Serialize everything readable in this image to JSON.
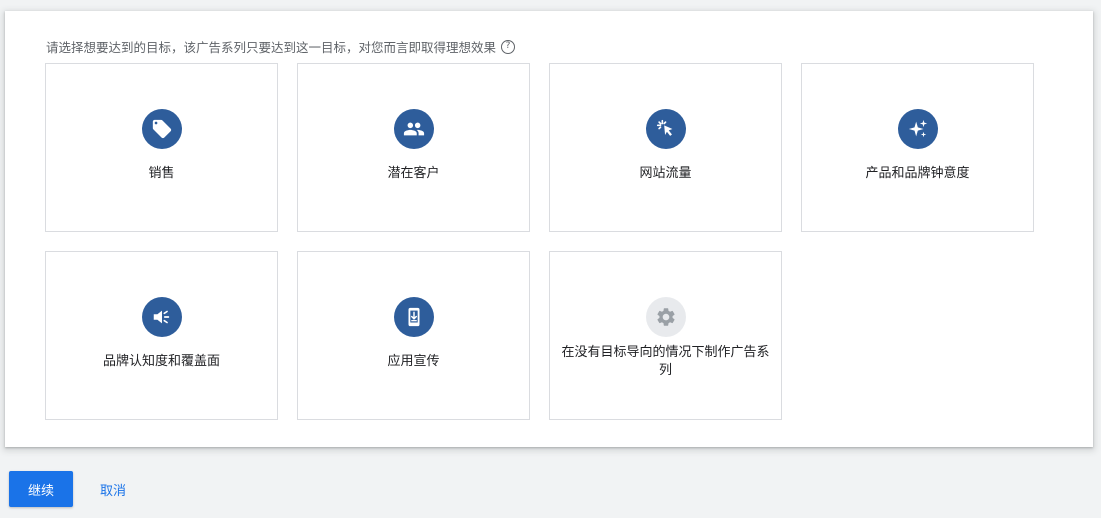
{
  "prompt": {
    "text": "请选择想要达到的目标，该广告系列只要达到这一目标，对您而言即取得理想效果",
    "help_icon": "?"
  },
  "goals": [
    {
      "label": "销售",
      "icon": "tag-icon"
    },
    {
      "label": "潜在客户",
      "icon": "people-icon"
    },
    {
      "label": "网站流量",
      "icon": "cursor-click-icon"
    },
    {
      "label": "产品和品牌钟意度",
      "icon": "sparkle-icon"
    },
    {
      "label": "品牌认知度和覆盖面",
      "icon": "megaphone-icon"
    },
    {
      "label": "应用宣传",
      "icon": "mobile-download-icon"
    },
    {
      "label": "在没有目标导向的情况下制作广告系列",
      "icon": "gear-icon"
    }
  ],
  "footer": {
    "continue_label": "继续",
    "cancel_label": "取消"
  },
  "colors": {
    "accent": "#1a73e8",
    "icon_bg": "#2e5d9b",
    "icon_bg_muted": "#e8eaed",
    "card_border": "#dadce0",
    "page_bg": "#f1f3f4"
  }
}
